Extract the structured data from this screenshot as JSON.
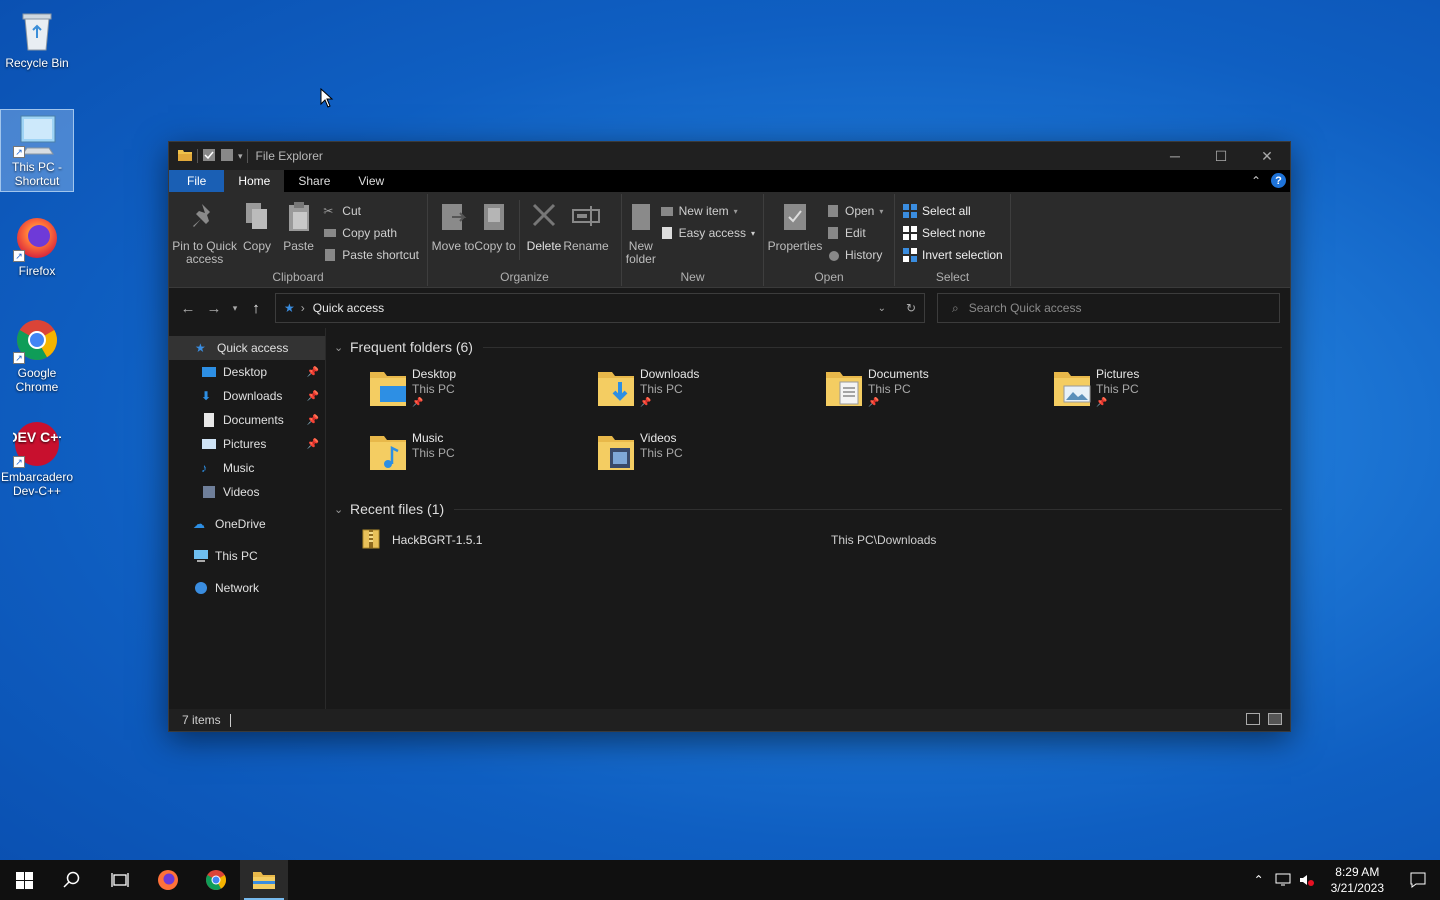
{
  "desktop": {
    "icons": [
      {
        "label": "Recycle Bin"
      },
      {
        "label": "This PC - Shortcut"
      },
      {
        "label": "Firefox"
      },
      {
        "label": "Google Chrome"
      },
      {
        "label": "Embarcadero Dev-C++"
      }
    ],
    "devcpp_logo_text": "DEV C++"
  },
  "window": {
    "title": "File Explorer",
    "tabs": [
      {
        "label": "File"
      },
      {
        "label": "Home"
      },
      {
        "label": "Share"
      },
      {
        "label": "View"
      }
    ],
    "help_label": "?",
    "ribbon": {
      "clipboard": {
        "label": "Clipboard",
        "pin": "Pin to Quick access",
        "copy": "Copy",
        "paste": "Paste",
        "cut": "Cut",
        "copy_path": "Copy path",
        "paste_shortcut": "Paste shortcut"
      },
      "organize": {
        "label": "Organize",
        "move_to": "Move to",
        "copy_to": "Copy to",
        "delete": "Delete",
        "rename": "Rename"
      },
      "new": {
        "label": "New",
        "new_folder": "New folder",
        "new_item": "New item",
        "easy_access": "Easy access"
      },
      "open": {
        "label": "Open",
        "properties": "Properties",
        "open": "Open",
        "edit": "Edit",
        "history": "History"
      },
      "select": {
        "label": "Select",
        "select_all": "Select all",
        "select_none": "Select none",
        "invert": "Invert selection"
      }
    },
    "address": {
      "path": "Quick access",
      "search_placeholder": "Search Quick access"
    },
    "nav": [
      {
        "label": "Quick access",
        "pinned": false
      },
      {
        "label": "Desktop",
        "pinned": true
      },
      {
        "label": "Downloads",
        "pinned": true
      },
      {
        "label": "Documents",
        "pinned": true
      },
      {
        "label": "Pictures",
        "pinned": true
      },
      {
        "label": "Music",
        "pinned": false
      },
      {
        "label": "Videos",
        "pinned": false
      },
      {
        "label": "OneDrive",
        "pinned": false
      },
      {
        "label": "This PC",
        "pinned": false
      },
      {
        "label": "Network",
        "pinned": false
      }
    ],
    "frequent": {
      "header": "Frequent folders (6)",
      "items": [
        {
          "name": "Desktop",
          "location": "This PC",
          "pinned": true
        },
        {
          "name": "Downloads",
          "location": "This PC",
          "pinned": true
        },
        {
          "name": "Documents",
          "location": "This PC",
          "pinned": true
        },
        {
          "name": "Pictures",
          "location": "This PC",
          "pinned": true
        },
        {
          "name": "Music",
          "location": "This PC",
          "pinned": false
        },
        {
          "name": "Videos",
          "location": "This PC",
          "pinned": false
        }
      ]
    },
    "recent": {
      "header": "Recent files (1)",
      "items": [
        {
          "name": "HackBGRT-1.5.1",
          "path": "This PC\\Downloads"
        }
      ]
    },
    "status": {
      "count": "7 items"
    }
  },
  "taskbar": {
    "time": "8:29 AM",
    "date": "3/21/2023"
  },
  "colors": {
    "accent": "#1a5fb4",
    "folder": "#f0c24a",
    "window_bg": "#191919"
  }
}
